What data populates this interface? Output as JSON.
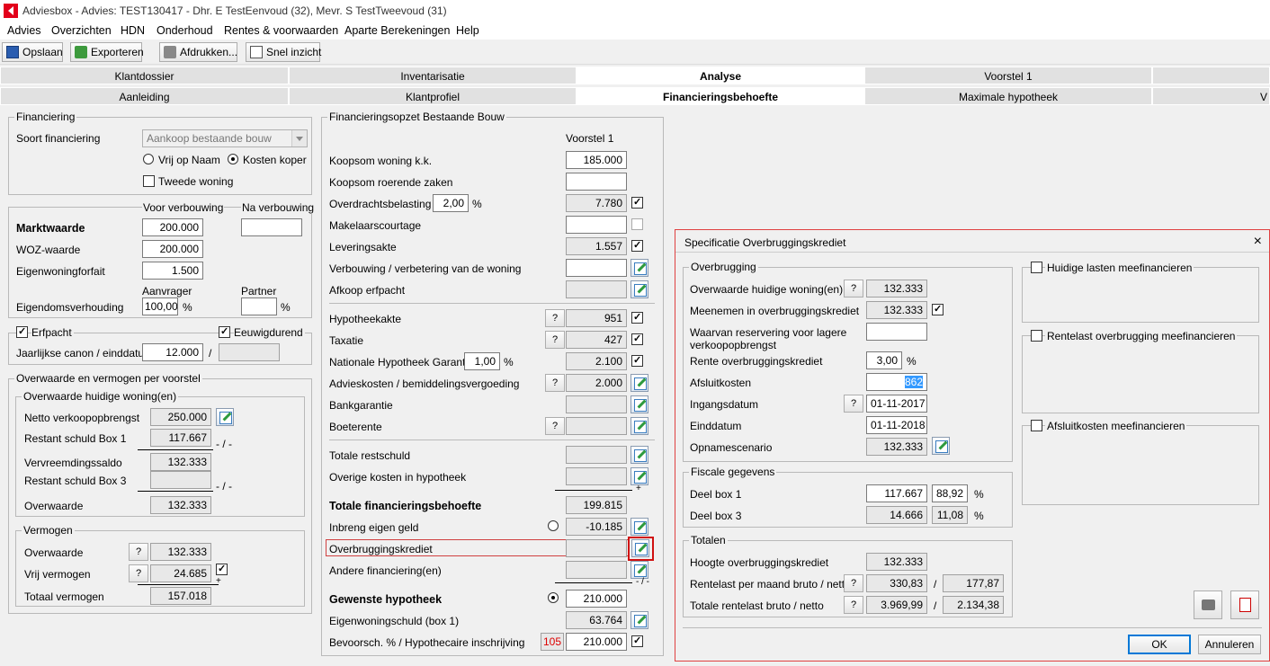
{
  "window": {
    "title": "Adviesbox - Advies: TEST130417 - Dhr. E TestEenvoud (32), Mevr. S TestTweevoud (31)"
  },
  "menu": [
    "Advies",
    "Overzichten",
    "HDN",
    "Onderhoud",
    "Rentes & voorwaarden",
    "Aparte Berekeningen",
    "Help"
  ],
  "toolbar": {
    "save": "Opslaan",
    "export": "Exporteren",
    "print": "Afdrukken...",
    "quick": "Snel inzicht"
  },
  "tabs_top": [
    "Klantdossier",
    "Inventarisatie",
    "Analyse",
    "Voorstel 1",
    ""
  ],
  "tabs_sub": [
    "Aanleiding",
    "Klantprofiel",
    "Financieringsbehoefte",
    "Maximale hypotheek",
    "V"
  ],
  "financiering": {
    "title": "Financiering",
    "soort_label": "Soort financiering",
    "soort_value": "Aankoop bestaande bouw",
    "radio1": "Vrij op Naam",
    "radio2": "Kosten koper",
    "tweede": "Tweede woning"
  },
  "waarde": {
    "voor": "Voor verbouwing",
    "na": "Na verbouwing",
    "markt_label": "Marktwaarde",
    "markt_value": "200.000",
    "woz_label": "WOZ-waarde",
    "woz_value": "200.000",
    "ewf_label": "Eigenwoningforfait",
    "ewf_value": "1.500",
    "aanvrager": "Aanvrager",
    "partner": "Partner",
    "eigendom_label": "Eigendomsverhouding",
    "eigendom_value": "100,00",
    "pct": "%"
  },
  "erfpacht": {
    "label": "Erfpacht",
    "eeuwig": "Eeuwigdurend",
    "canon_label": "Jaarlijkse canon / einddatum",
    "canon_value": "12.000",
    "slash": "/"
  },
  "overwaarde": {
    "title": "Overwaarde en vermogen per voorstel",
    "sub_title": "Overwaarde huidige woning(en)",
    "netto_label": "Netto verkoopopbrengst",
    "netto_value": "250.000",
    "restant1_label": "Restant schuld Box 1",
    "restant1_value": "117.667",
    "minus": "- / -",
    "vervreemding_label": "Vervreemdingssaldo",
    "vervreemding_value": "132.333",
    "restant3_label": "Restant schuld Box 3",
    "overwaarde_label": "Overwaarde",
    "overwaarde_value": "132.333"
  },
  "vermogen": {
    "title": "Vermogen",
    "overwaarde_label": "Overwaarde",
    "overwaarde_value": "132.333",
    "vrij_label": "Vrij vermogen",
    "vrij_value": "24.685",
    "plus": "+",
    "totaal_label": "Totaal vermogen",
    "totaal_value": "157.018",
    "q": "?"
  },
  "opzet": {
    "title": "Financieringsopzet Bestaande Bouw",
    "col": "Voorstel 1",
    "koopsom_label": "Koopsom woning k.k.",
    "koopsom_value": "185.000",
    "roerend_label": "Koopsom roerende zaken",
    "overdracht_label": "Overdrachtsbelasting",
    "overdracht_pct": "2,00",
    "overdracht_value": "7.780",
    "makelaar_label": "Makelaarscourtage",
    "levering_label": "Leveringsakte",
    "levering_value": "1.557",
    "verbouwing_label": "Verbouwing / verbetering van de woning",
    "afkoop_label": "Afkoop erfpacht",
    "hypotheekakte_label": "Hypotheekakte",
    "hypotheekakte_value": "951",
    "taxatie_label": "Taxatie",
    "taxatie_value": "427",
    "nhg_label": "Nationale Hypotheek Garantie",
    "nhg_pct": "1,00",
    "nhg_value": "2.100",
    "advies_label": "Advieskosten / bemiddelingsvergoeding",
    "advies_value": "2.000",
    "bankgarantie_label": "Bankgarantie",
    "boeterente_label": "Boeterente",
    "restschuld_label": "Totale restschuld",
    "overige_label": "Overige kosten in hypotheek",
    "plus": "+",
    "totaal_label": "Totale financieringsbehoefte",
    "totaal_value": "199.815",
    "inbreng_label": "Inbreng eigen geld",
    "inbreng_value": "-10.185",
    "overbrugging_label": "Overbruggingskrediet",
    "andere_label": "Andere financiering(en)",
    "minus": "- / -",
    "gewenste_label": "Gewenste hypotheek",
    "gewenste_value": "210.000",
    "eigenwoning_label": "Eigenwoningschuld (box 1)",
    "eigenwoning_value": "63.764",
    "bevoorsch_label": "Bevoorsch. % / Hypothecaire inschrijving",
    "bevoorsch_pct": "105",
    "bevoorsch_value": "210.000",
    "q": "?",
    "pct": "%"
  },
  "dialog": {
    "title": "Specificatie Overbruggingskrediet",
    "close": "×",
    "overbrugging_title": "Overbrugging",
    "ow_label": "Overwaarde huidige woning(en)",
    "ow_value": "132.333",
    "meenemen_label": "Meenemen in overbruggingskrediet",
    "meenemen_value": "132.333",
    "reservering_label": "Waarvan reservering voor lagere verkoopopbrengst",
    "rente_label": "Rente overbruggingskrediet",
    "rente_value": "3,00",
    "afsluit_label": "Afsluitkosten",
    "afsluit_value": "862",
    "ingang_label": "Ingangsdatum",
    "ingang_value": "01-11-2017",
    "eind_label": "Einddatum",
    "eind_value": "01-11-2018",
    "opname_label": "Opnamescenario",
    "opname_value": "132.333",
    "fiscaal_title": "Fiscale gegevens",
    "box1_label": "Deel box 1",
    "box1_value": "117.667",
    "box1_pct": "88,92",
    "box3_label": "Deel box 3",
    "box3_value": "14.666",
    "box3_pct": "11,08",
    "totalen_title": "Totalen",
    "hoogte_label": "Hoogte overbruggingskrediet",
    "hoogte_value": "132.333",
    "rentelast_label": "Rentelast per maand bruto / netto",
    "rentelast_bruto": "330,83",
    "rentelast_netto": "177,87",
    "totale_label": "Totale rentelast bruto / netto",
    "totale_bruto": "3.969,99",
    "totale_netto": "2.134,38",
    "lasten_label": "Huidige lasten meefinancieren",
    "rentelast_mee_label": "Rentelast overbrugging meefinancieren",
    "afsluit_mee_label": "Afsluitkosten meefinancieren",
    "ok": "OK",
    "annuleren": "Annuleren",
    "q": "?",
    "pct": "%",
    "slash": "/"
  },
  "colors": {
    "accent": "#e3001b",
    "highlight": "#3399ff",
    "dialog_border": "#e04040"
  }
}
